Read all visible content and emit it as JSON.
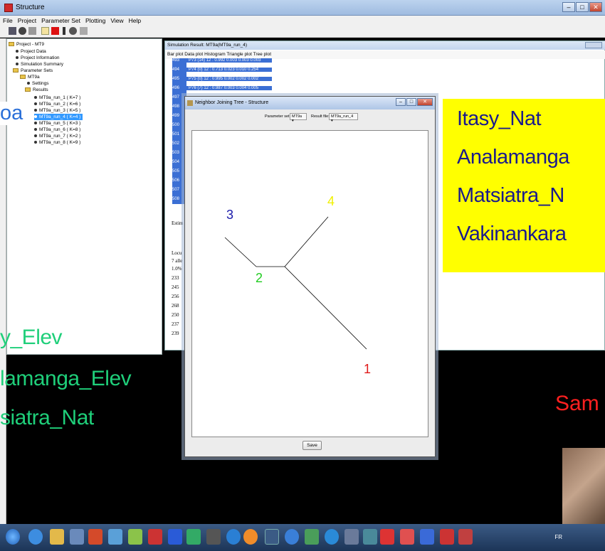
{
  "window": {
    "title": "Structure",
    "controls": [
      "–",
      "□",
      "✕"
    ]
  },
  "menubar": [
    "File",
    "Project",
    "Parameter Set",
    "Plotting",
    "View",
    "Help"
  ],
  "tree": {
    "items": [
      "Project - MT9",
      "Project Data",
      "Project Information",
      "Simulation Summary",
      "Parameter Sets",
      "MT9a",
      "Settings",
      "Results",
      "MT9a_run_1 ( K=7 )",
      "MT9a_run_2 ( K=6 )",
      "MT9a_run_3 ( K=5 )",
      "MT9a_run_4 ( K=4 )",
      "MT9a_run_5 ( K=3 )",
      "MT9a_run_6 ( K=8 )",
      "MT9a_run_7 ( K=2 )",
      "MT9a_run_8 ( K=9 )"
    ]
  },
  "sim": {
    "title": "Simulation Result: MT9a(MT9a_run_4)",
    "tabs": [
      "Bar plot",
      "Data plot",
      "Histogram",
      "Triangle plot",
      "Tree plot"
    ],
    "rows": [
      {
        "n": "493",
        "t": "P73  (14)  12 :  0.992 0.003 0.003 0.003"
      },
      {
        "n": "494",
        "t": "P74  (0)  12 :  0.713 0.023 0.010 0.254"
      },
      {
        "n": "495",
        "t": "P75  (0)  12 :  0.995 0.002 0.002 0.002"
      },
      {
        "n": "496",
        "t": "P76  (7)  12 :  0.987 0.003 0.004 0.005"
      },
      {
        "n": "497",
        "t": ""
      },
      {
        "n": "498",
        "t": ""
      },
      {
        "n": "499",
        "t": ""
      },
      {
        "n": "500",
        "t": ""
      },
      {
        "n": "501",
        "t": ""
      },
      {
        "n": "502",
        "t": ""
      },
      {
        "n": "503",
        "t": ""
      },
      {
        "n": "504",
        "t": ""
      },
      {
        "n": "505",
        "t": ""
      },
      {
        "n": "506",
        "t": ""
      },
      {
        "n": "507",
        "t": ""
      },
      {
        "n": "508",
        "t": ""
      }
    ],
    "side_text": [
      "Estim",
      "Locu",
      "7 alle",
      "1.0%",
      "233",
      "245",
      "256",
      "268",
      "250",
      "237",
      "239"
    ]
  },
  "dialog": {
    "title": "Neighbor Joining Tree - Structure",
    "param_label": "Parameter set:",
    "param_value": "MT9a",
    "result_label": "Result file:",
    "result_value": "MT9a_run_4",
    "save_label": "Save",
    "node_labels": [
      {
        "text": "1",
        "color": "#e01a1a"
      },
      {
        "text": "2",
        "color": "#22cc22"
      },
      {
        "text": "3",
        "color": "#1a1aaa"
      },
      {
        "text": "4",
        "color": "#f0f000"
      }
    ]
  },
  "overlay": {
    "left_fragment": "oa",
    "yellow_lines": [
      "Itasy_Nat",
      "Analamanga",
      "Matsiatra_N",
      "Vakinankara"
    ],
    "green_lines": [
      "y_Elev",
      "lamanga_Elev",
      "siatra_Nat"
    ],
    "red_fragment": "Sam",
    "colors": {
      "green": "#1fcf7a",
      "yellow_box": "#ffff00",
      "red": "#ff2020",
      "blue_text": "#1a1a8c"
    }
  },
  "taskbar": {
    "tray_text": "FR"
  }
}
